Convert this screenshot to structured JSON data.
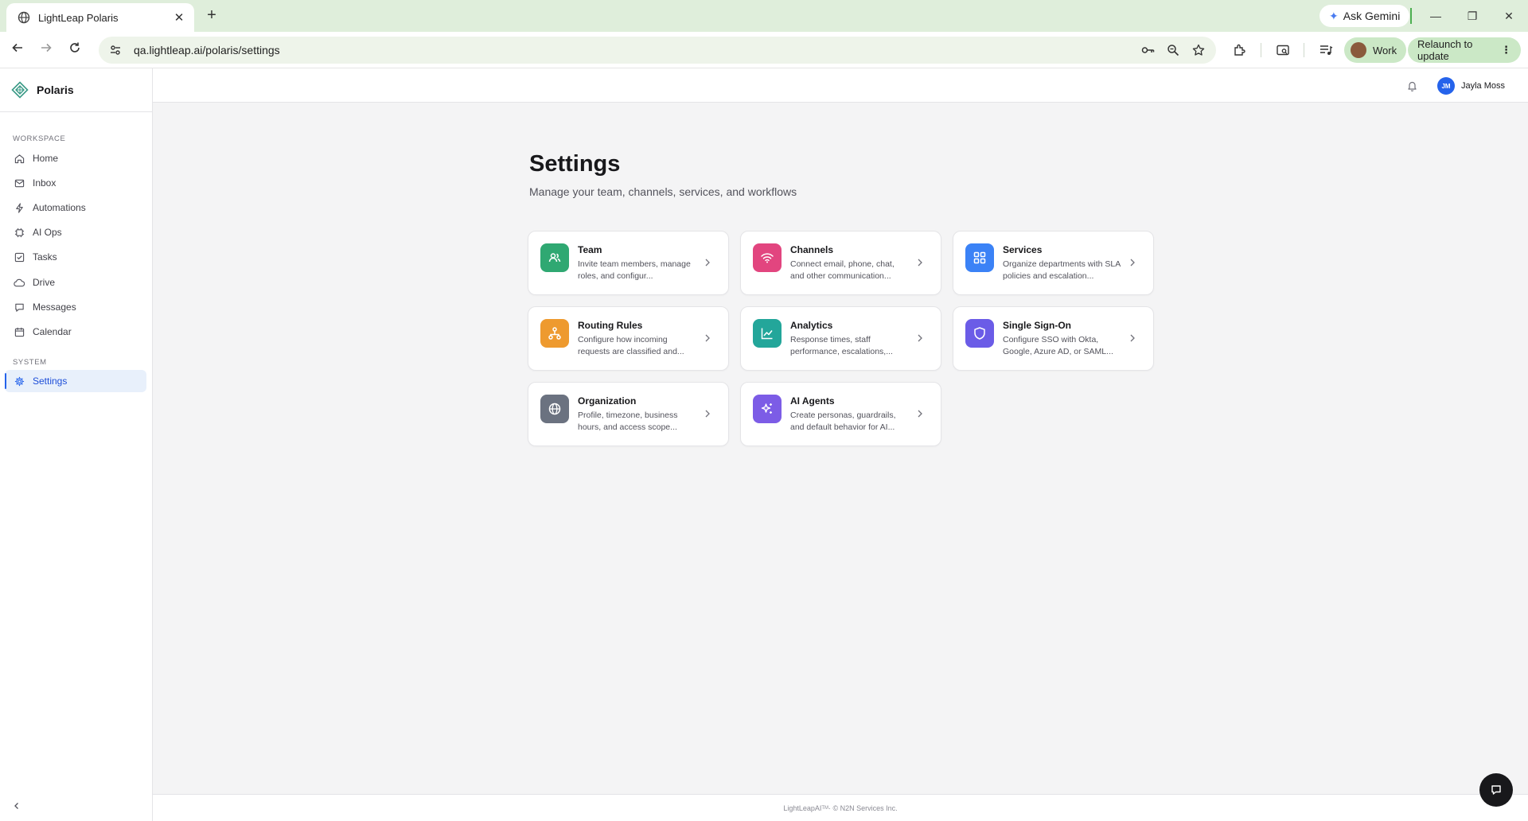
{
  "browser": {
    "tab_title": "LightLeap Polaris",
    "tab_close": "✕",
    "new_tab": "+",
    "url": "qa.lightleap.ai/polaris/settings",
    "gemini_label": "Ask Gemini",
    "profile_label": "Work",
    "relaunch_label": "Relaunch to update"
  },
  "sidebar": {
    "brand": "Polaris",
    "workspace_label": "WORKSPACE",
    "system_label": "SYSTEM",
    "workspace_items": [
      {
        "label": "Home",
        "icon": "home-icon"
      },
      {
        "label": "Inbox",
        "icon": "inbox-icon"
      },
      {
        "label": "Automations",
        "icon": "bolt-icon"
      },
      {
        "label": "AI Ops",
        "icon": "chip-icon"
      },
      {
        "label": "Tasks",
        "icon": "checkbox-icon"
      },
      {
        "label": "Drive",
        "icon": "cloud-icon"
      },
      {
        "label": "Messages",
        "icon": "chat-icon"
      },
      {
        "label": "Calendar",
        "icon": "calendar-icon"
      }
    ],
    "system_items": [
      {
        "label": "Settings",
        "icon": "gear-icon",
        "active": true
      }
    ]
  },
  "topbar": {
    "user_initials": "JM",
    "user_name": "Jayla Moss"
  },
  "page": {
    "title": "Settings",
    "subtitle": "Manage your team, channels, services, and workflows"
  },
  "cards": [
    {
      "title": "Team",
      "desc": "Invite team members, manage roles, and configur...",
      "icon": "users-icon",
      "color": "#2fa872"
    },
    {
      "title": "Channels",
      "desc": "Connect email, phone, chat, and other communication...",
      "icon": "wifi-icon",
      "color": "#e2457f"
    },
    {
      "title": "Services",
      "desc": "Organize departments with SLA policies and escalation...",
      "icon": "grid-icon",
      "color": "#3b82f6"
    },
    {
      "title": "Routing Rules",
      "desc": "Configure how incoming requests are classified and...",
      "icon": "routing-icon",
      "color": "#ee9a2f"
    },
    {
      "title": "Analytics",
      "desc": "Response times, staff performance, escalations,...",
      "icon": "chart-icon",
      "color": "#23a69a"
    },
    {
      "title": "Single Sign-On",
      "desc": "Configure SSO with Okta, Google, Azure AD, or SAML...",
      "icon": "shield-icon",
      "color": "#6b5ce7"
    },
    {
      "title": "Organization",
      "desc": "Profile, timezone, business hours, and access scope...",
      "icon": "globe-icon",
      "color": "#6b7280"
    },
    {
      "title": "AI Agents",
      "desc": "Create personas, guardrails, and default behavior for AI...",
      "icon": "sparkles-icon",
      "color": "#7c5ce6"
    }
  ],
  "footer": {
    "brand": "LightLeapAI",
    "tm": "TM",
    "rest": " · © N2N Services Inc."
  }
}
